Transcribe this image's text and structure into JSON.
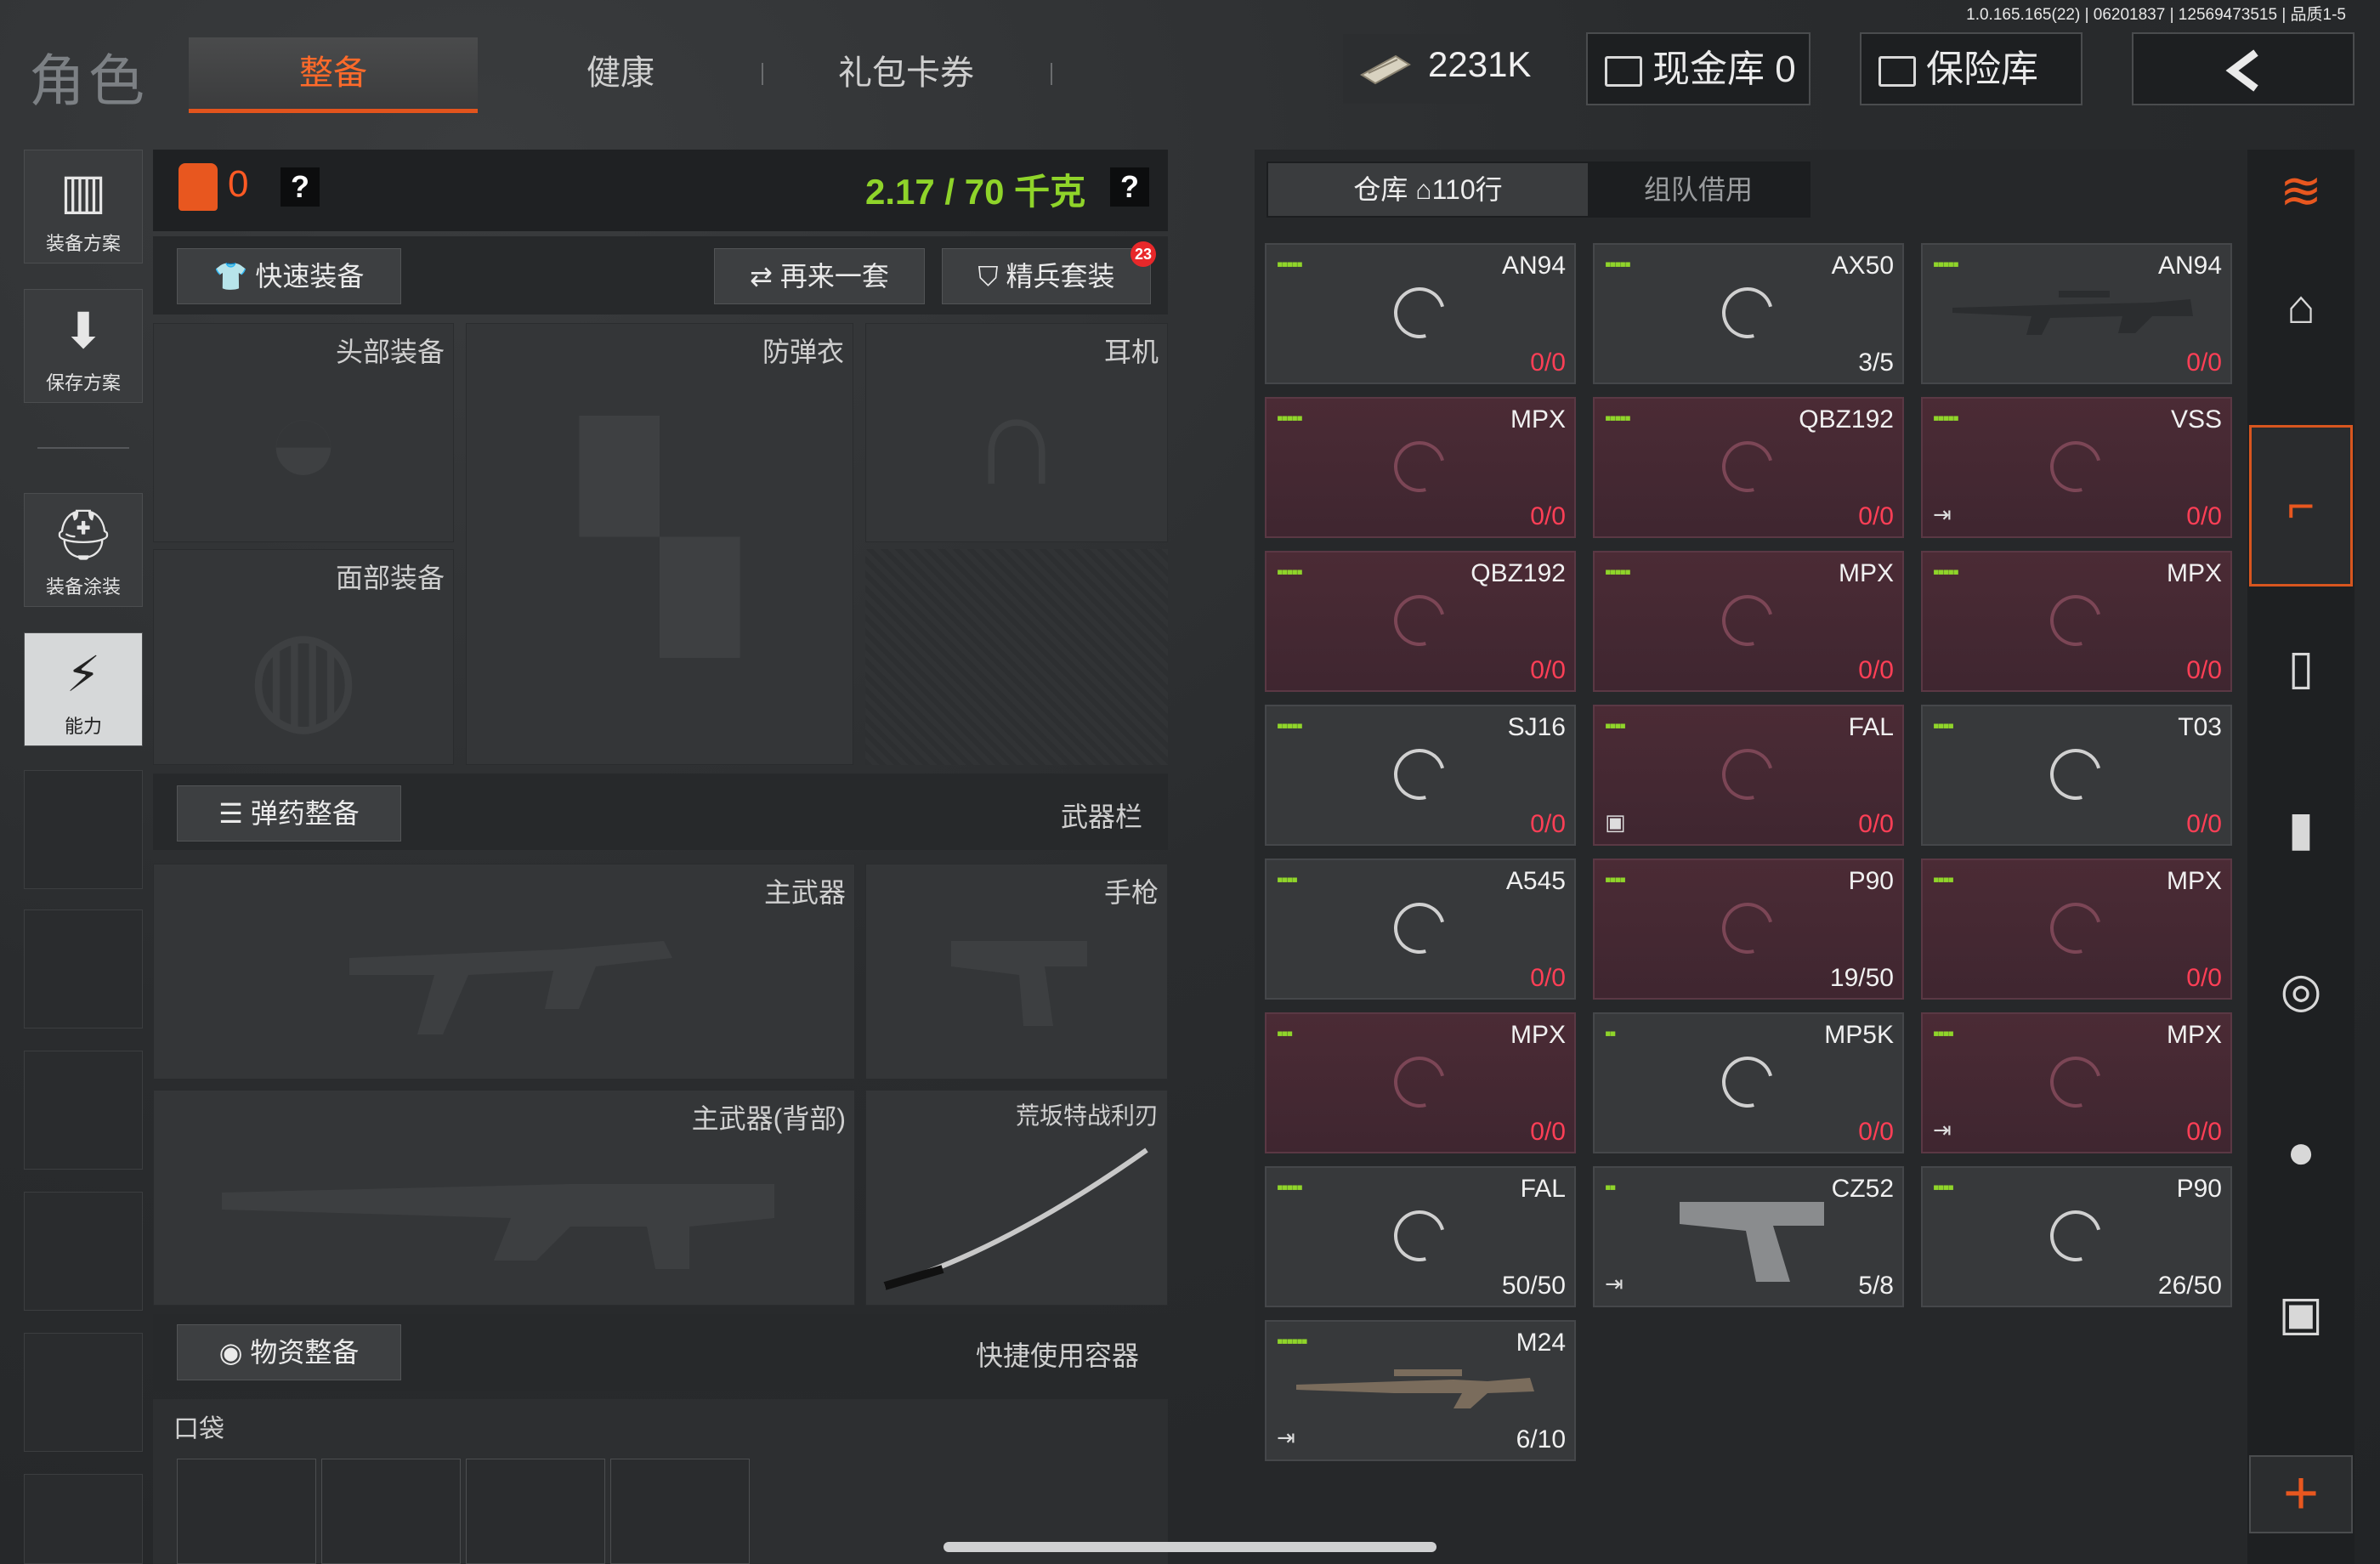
{
  "version": "1.0.165.165(22) | 06201837 | 12569473515 | 品质1-5",
  "header": {
    "title": "角色",
    "tabs": [
      "整备",
      "健康",
      "礼包卡券"
    ],
    "money": "2231K",
    "cash_vault": "现金库 0",
    "safe_vault": "保险库"
  },
  "left_sidebar": {
    "items": [
      "装备方案",
      "保存方案",
      "装备涂装",
      "能力"
    ]
  },
  "equipment": {
    "lock_count": "0",
    "help": "?",
    "weight": "2.17 / 70 千克",
    "quick_equip": "快速装备",
    "again": "再来一套",
    "elite": "精兵套装",
    "elite_badge": "23",
    "slots": {
      "head": "头部装备",
      "vest": "防弹衣",
      "ear": "耳机",
      "face": "面部装备",
      "main": "主武器",
      "pistol": "手枪",
      "back": "主武器(背部)",
      "blade": "荒坂特战利刃"
    },
    "ammo_equip": "弹药整备",
    "weapon_bar": "武器栏",
    "supply_equip": "物资整备",
    "quick_container": "快捷使用容器",
    "pocket": "口袋"
  },
  "warehouse": {
    "tab1": "仓库",
    "tab1_count": "110行",
    "tab2": "组队借用",
    "items": [
      {
        "name": "AN94",
        "bars": "▪▪▪▪▪",
        "count": "0/0",
        "red": false,
        "zero": true,
        "spinner": true,
        "ext": ""
      },
      {
        "name": "AX50",
        "bars": "▪▪▪▪▪",
        "count": "3/5",
        "red": false,
        "zero": false,
        "spinner": true,
        "ext": ""
      },
      {
        "name": "AN94",
        "bars": "▪▪▪▪▪",
        "count": "0/0",
        "red": false,
        "zero": true,
        "spinner": false,
        "ext": "",
        "gun": "rifle"
      },
      {
        "name": "MPX",
        "bars": "▪▪▪▪▪",
        "count": "0/0",
        "red": true,
        "zero": true,
        "spinner": true,
        "ext": ""
      },
      {
        "name": "QBZ192",
        "bars": "▪▪▪▪▪",
        "count": "0/0",
        "red": true,
        "zero": true,
        "spinner": true,
        "ext": ""
      },
      {
        "name": "VSS",
        "bars": "▪▪▪▪▪",
        "count": "0/0",
        "red": true,
        "zero": true,
        "spinner": true,
        "ext": "⇥"
      },
      {
        "name": "QBZ192",
        "bars": "▪▪▪▪▪",
        "count": "0/0",
        "red": true,
        "zero": true,
        "spinner": true,
        "ext": ""
      },
      {
        "name": "MPX",
        "bars": "▪▪▪▪▪",
        "count": "0/0",
        "red": true,
        "zero": true,
        "spinner": true,
        "ext": ""
      },
      {
        "name": "MPX",
        "bars": "▪▪▪▪▪",
        "count": "0/0",
        "red": true,
        "zero": true,
        "spinner": true,
        "ext": ""
      },
      {
        "name": "SJ16",
        "bars": "▪▪▪▪▪",
        "count": "0/0",
        "red": false,
        "zero": true,
        "spinner": true,
        "ext": ""
      },
      {
        "name": "FAL",
        "bars": "▪▪▪▪",
        "count": "0/0",
        "red": true,
        "zero": true,
        "spinner": true,
        "ext": "▣"
      },
      {
        "name": "T03",
        "bars": "▪▪▪▪",
        "count": "0/0",
        "red": false,
        "zero": true,
        "spinner": true,
        "ext": ""
      },
      {
        "name": "A545",
        "bars": "▪▪▪▪",
        "count": "0/0",
        "red": false,
        "zero": true,
        "spinner": true,
        "ext": ""
      },
      {
        "name": "P90",
        "bars": "▪▪▪▪",
        "count": "19/50",
        "red": true,
        "zero": false,
        "spinner": true,
        "ext": ""
      },
      {
        "name": "MPX",
        "bars": "▪▪▪▪",
        "count": "0/0",
        "red": true,
        "zero": true,
        "spinner": true,
        "ext": ""
      },
      {
        "name": "MPX",
        "bars": "▪▪▪",
        "count": "0/0",
        "red": true,
        "zero": true,
        "spinner": true,
        "ext": ""
      },
      {
        "name": "MP5K",
        "bars": "▪▪",
        "count": "0/0",
        "red": false,
        "zero": true,
        "spinner": true,
        "ext": ""
      },
      {
        "name": "MPX",
        "bars": "▪▪▪▪",
        "count": "0/0",
        "red": true,
        "zero": true,
        "spinner": true,
        "ext": "⇥"
      },
      {
        "name": "FAL",
        "bars": "▪▪▪▪▪",
        "count": "50/50",
        "red": false,
        "zero": false,
        "spinner": true,
        "ext": ""
      },
      {
        "name": "CZ52",
        "bars": "▪▪",
        "count": "5/8",
        "red": false,
        "zero": false,
        "spinner": false,
        "ext": "⇥",
        "gun": "pistol"
      },
      {
        "name": "P90",
        "bars": "▪▪▪▪",
        "count": "26/50",
        "red": false,
        "zero": false,
        "spinner": true,
        "ext": ""
      },
      {
        "name": "M24",
        "bars": "▪▪▪▪▪▪",
        "count": "6/10",
        "red": false,
        "zero": false,
        "spinner": false,
        "ext": "⇥",
        "gun": "sniper"
      }
    ]
  },
  "right_rail": {
    "icons": [
      "stack-refresh-icon",
      "home-icon",
      "gun-icon",
      "magazine-icon",
      "bullet-icon",
      "scope-icon",
      "grenade-icon",
      "medkit-icon"
    ],
    "add": "+"
  },
  "colors": {
    "accent": "#e2541d",
    "green": "#8fd42a",
    "red": "#ff3f56"
  }
}
